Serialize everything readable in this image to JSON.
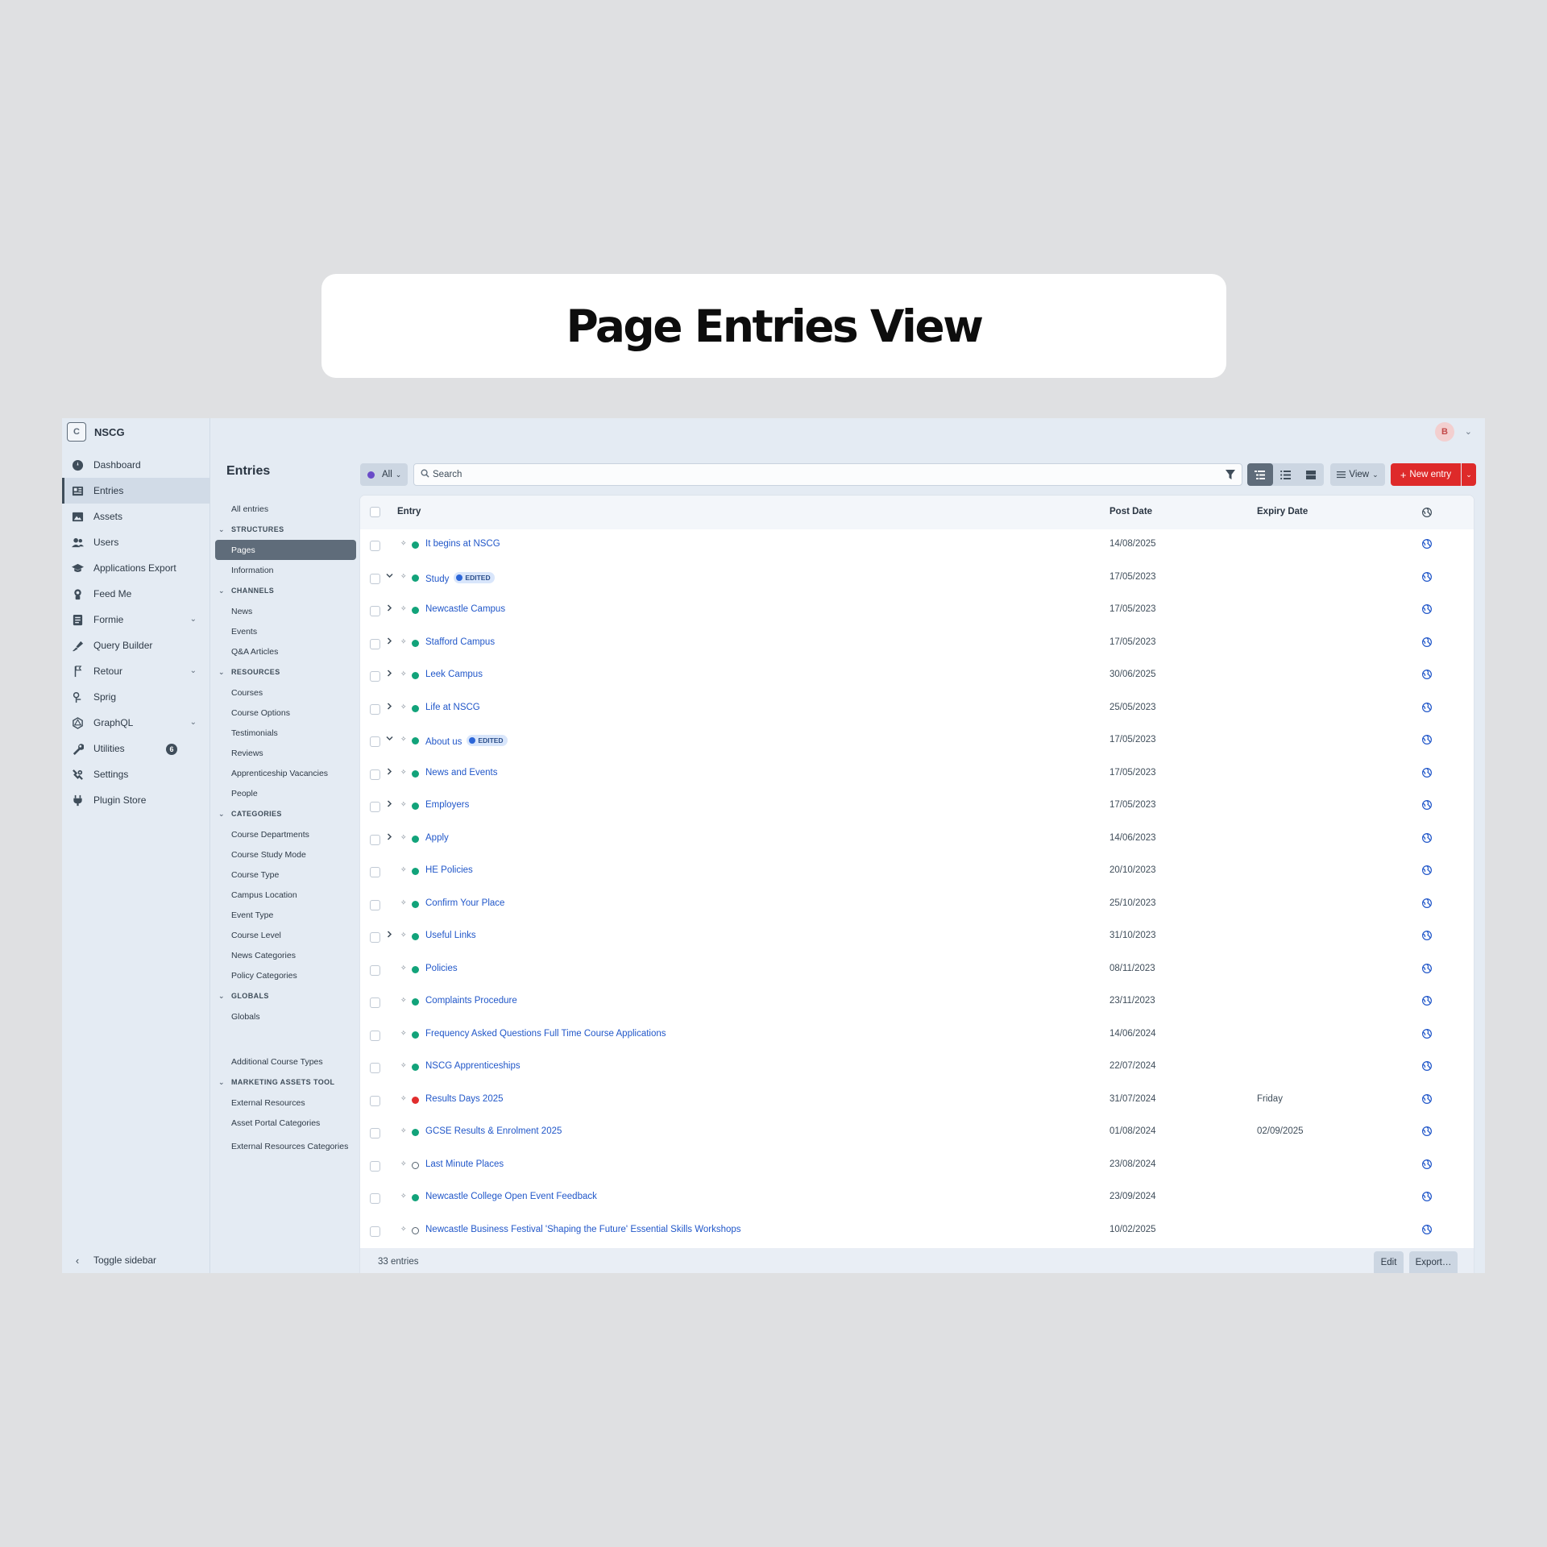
{
  "banner": {
    "title": "Page Entries View"
  },
  "site": {
    "icon_letter": "C",
    "name": "NSCG"
  },
  "user": {
    "avatar_letter": "B"
  },
  "nav": [
    {
      "label": "Dashboard",
      "icon": "dashboard-icon"
    },
    {
      "label": "Entries",
      "icon": "entries-icon",
      "active": true
    },
    {
      "label": "Assets",
      "icon": "assets-icon"
    },
    {
      "label": "Users",
      "icon": "users-icon"
    },
    {
      "label": "Applications Export",
      "icon": "graduation-cap-icon"
    },
    {
      "label": "Feed Me",
      "icon": "feed-me-icon"
    },
    {
      "label": "Formie",
      "icon": "formie-icon",
      "has_submenu": true
    },
    {
      "label": "Query Builder",
      "icon": "query-builder-icon"
    },
    {
      "label": "Retour",
      "icon": "retour-icon",
      "has_submenu": true
    },
    {
      "label": "Sprig",
      "icon": "sprig-icon"
    },
    {
      "label": "GraphQL",
      "icon": "graphql-icon",
      "has_submenu": true
    },
    {
      "label": "Utilities",
      "icon": "wrench-icon",
      "badge": "6"
    },
    {
      "label": "Settings",
      "icon": "settings-icon"
    },
    {
      "label": "Plugin Store",
      "icon": "plug-icon"
    }
  ],
  "toggle_sidebar": "Toggle sidebar",
  "entries_sidebar": {
    "title": "Entries",
    "all_entries": "All entries",
    "groups": [
      {
        "heading": "STRUCTURES",
        "items": [
          "Pages",
          "Information"
        ]
      },
      {
        "heading": "CHANNELS",
        "items": [
          "News",
          "Events",
          "Q&A Articles"
        ]
      },
      {
        "heading": "RESOURCES",
        "items": [
          "Courses",
          "Course Options",
          "Testimonials",
          "Reviews",
          "Apprenticeship Vacancies",
          "People"
        ]
      },
      {
        "heading": "CATEGORIES",
        "items": [
          "Course Departments",
          "Course Study Mode",
          "Course Type",
          "Campus Location",
          "Event Type",
          "Course Level",
          "News Categories",
          "Policy Categories"
        ]
      },
      {
        "heading": "GLOBALS",
        "items": [
          "Globals"
        ]
      }
    ],
    "additional": "Additional Course Types",
    "marketing": {
      "heading": "MARKETING ASSETS TOOL",
      "items": [
        "External Resources",
        "Asset Portal Categories",
        "External Resources Categories"
      ]
    },
    "active_item": "Pages"
  },
  "toolbar": {
    "site_filter": "All",
    "search_placeholder": "Search",
    "view_label": "View",
    "new_entry_label": "New entry"
  },
  "table": {
    "columns": {
      "entry": "Entry",
      "post_date": "Post Date",
      "expiry_date": "Expiry Date"
    },
    "edited_label": "EDITED",
    "rows": [
      {
        "title": "It begins at NSCG",
        "status": "live",
        "toggle": "",
        "post_date": "14/08/2025",
        "expiry_date": ""
      },
      {
        "title": "Study",
        "status": "live",
        "toggle": "expanded",
        "edited": true,
        "post_date": "17/05/2023",
        "expiry_date": ""
      },
      {
        "title": "Newcastle Campus",
        "status": "live",
        "toggle": "collapsed",
        "post_date": "17/05/2023",
        "expiry_date": ""
      },
      {
        "title": "Stafford Campus",
        "status": "live",
        "toggle": "collapsed",
        "post_date": "17/05/2023",
        "expiry_date": ""
      },
      {
        "title": "Leek Campus",
        "status": "live",
        "toggle": "collapsed",
        "post_date": "30/06/2025",
        "expiry_date": ""
      },
      {
        "title": "Life at NSCG",
        "status": "live",
        "toggle": "collapsed",
        "post_date": "25/05/2023",
        "expiry_date": ""
      },
      {
        "title": "About us",
        "status": "live",
        "toggle": "expanded",
        "edited": true,
        "post_date": "17/05/2023",
        "expiry_date": ""
      },
      {
        "title": "News and Events",
        "status": "live",
        "toggle": "collapsed",
        "post_date": "17/05/2023",
        "expiry_date": ""
      },
      {
        "title": "Employers",
        "status": "live",
        "toggle": "collapsed",
        "post_date": "17/05/2023",
        "expiry_date": ""
      },
      {
        "title": "Apply",
        "status": "live",
        "toggle": "collapsed",
        "post_date": "14/06/2023",
        "expiry_date": ""
      },
      {
        "title": "HE Policies",
        "status": "live",
        "toggle": "",
        "post_date": "20/10/2023",
        "expiry_date": ""
      },
      {
        "title": "Confirm Your Place",
        "status": "live",
        "toggle": "",
        "post_date": "25/10/2023",
        "expiry_date": ""
      },
      {
        "title": "Useful Links",
        "status": "live",
        "toggle": "collapsed",
        "post_date": "31/10/2023",
        "expiry_date": ""
      },
      {
        "title": "Policies",
        "status": "live",
        "toggle": "",
        "post_date": "08/11/2023",
        "expiry_date": ""
      },
      {
        "title": "Complaints Procedure",
        "status": "live",
        "toggle": "",
        "post_date": "23/11/2023",
        "expiry_date": ""
      },
      {
        "title": "Frequency Asked Questions Full Time Course Applications",
        "status": "live",
        "toggle": "",
        "post_date": "14/06/2024",
        "expiry_date": ""
      },
      {
        "title": "NSCG Apprenticeships",
        "status": "live",
        "toggle": "",
        "post_date": "22/07/2024",
        "expiry_date": ""
      },
      {
        "title": "Results Days 2025",
        "status": "expired",
        "toggle": "",
        "post_date": "31/07/2024",
        "expiry_date": "Friday"
      },
      {
        "title": "GCSE Results & Enrolment 2025",
        "status": "live",
        "toggle": "",
        "post_date": "01/08/2024",
        "expiry_date": "02/09/2025"
      },
      {
        "title": "Last Minute Places",
        "status": "disabled",
        "toggle": "",
        "post_date": "23/08/2024",
        "expiry_date": ""
      },
      {
        "title": "Newcastle College Open Event Feedback",
        "status": "live",
        "toggle": "",
        "post_date": "23/09/2024",
        "expiry_date": ""
      },
      {
        "title": "Newcastle Business Festival 'Shaping the Future' Essential Skills Workshops",
        "status": "disabled",
        "toggle": "",
        "post_date": "10/02/2025",
        "expiry_date": ""
      }
    ],
    "footer": {
      "count": "33 entries",
      "edit": "Edit",
      "export": "Export…"
    }
  },
  "colors": {
    "accent_red": "#de2a2a",
    "link_blue": "#2157c9",
    "live_green": "#12a37a",
    "expired_red": "#e12d2d"
  }
}
